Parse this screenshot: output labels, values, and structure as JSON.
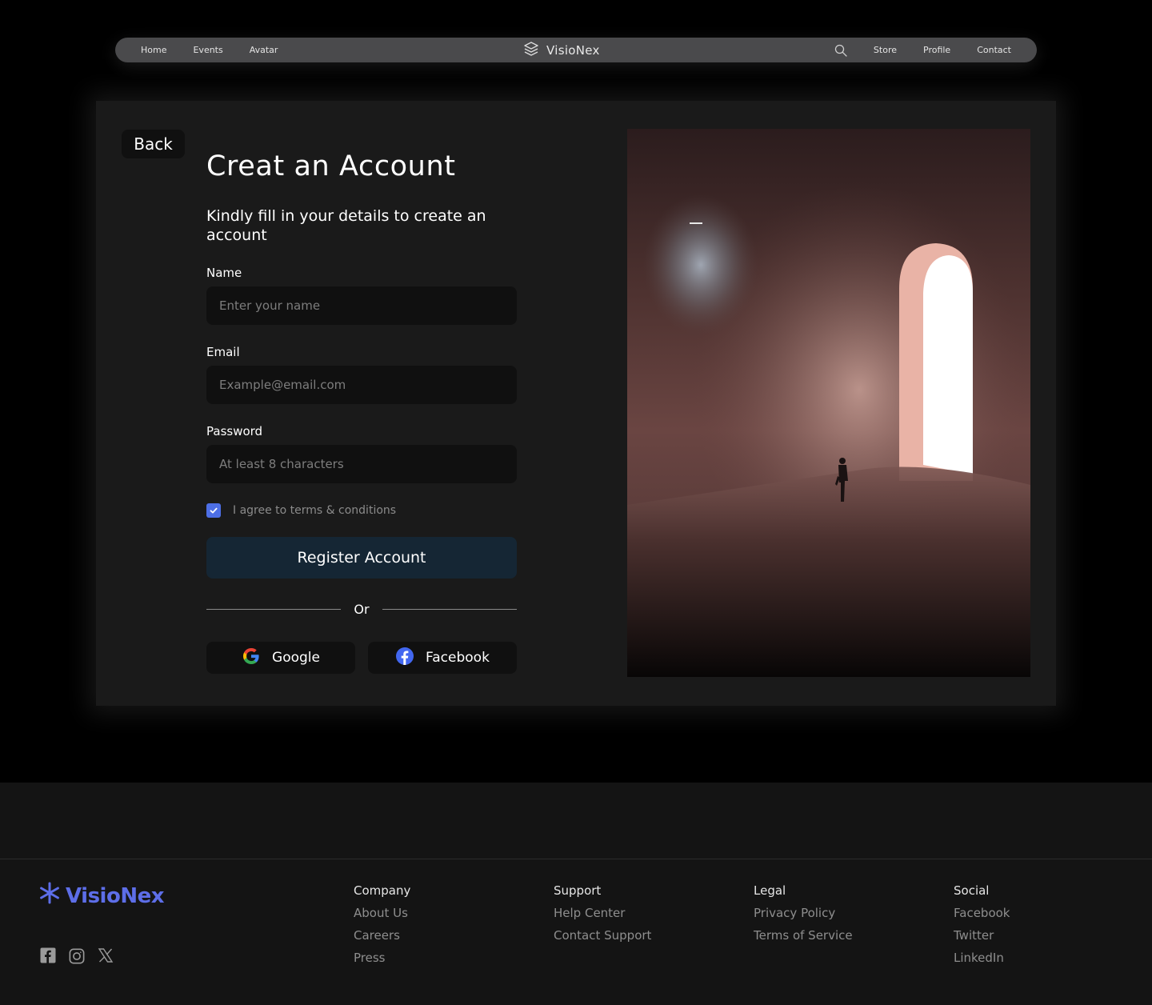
{
  "nav": {
    "left_links": [
      "Home",
      "Events",
      "Avatar"
    ],
    "brand": "VisioNex",
    "right_links": [
      "Store",
      "Profile",
      "Contact"
    ],
    "search_icon": "search-icon"
  },
  "card": {
    "back_label": "Back",
    "title": "Creat an Account",
    "subtitle": "Kindly fill in your details to create an account",
    "name_label": "Name",
    "name_placeholder": "Enter your name",
    "email_label": "Email",
    "email_placeholder": "Example@email.com",
    "password_label": "Password",
    "password_placeholder": "At least 8 characters",
    "agree_label": "I agree to terms & conditions",
    "agree_checked": true,
    "register_label": "Register Account",
    "or_label": "Or",
    "google_label": "Google",
    "facebook_label": "Facebook"
  },
  "footer": {
    "brand": "VisioNex",
    "brand_color": "#5d6ee8",
    "social_icons": [
      "facebook-icon",
      "instagram-icon",
      "x-twitter-icon"
    ],
    "columns": [
      {
        "heading": "Company",
        "links": [
          "About Us",
          "Careers",
          "Press"
        ]
      },
      {
        "heading": "Support",
        "links": [
          "Help Center",
          "Contact Support"
        ]
      },
      {
        "heading": "Legal",
        "links": [
          "Privacy Policy",
          "Terms of Service"
        ]
      },
      {
        "heading": "Social",
        "links": [
          "Facebook",
          "Twitter",
          "LinkedIn"
        ]
      }
    ]
  },
  "colors": {
    "accent_blue": "#4d6fe6",
    "register_button": "#152634",
    "card_background": "#1a1a1a",
    "input_background": "#101010"
  }
}
